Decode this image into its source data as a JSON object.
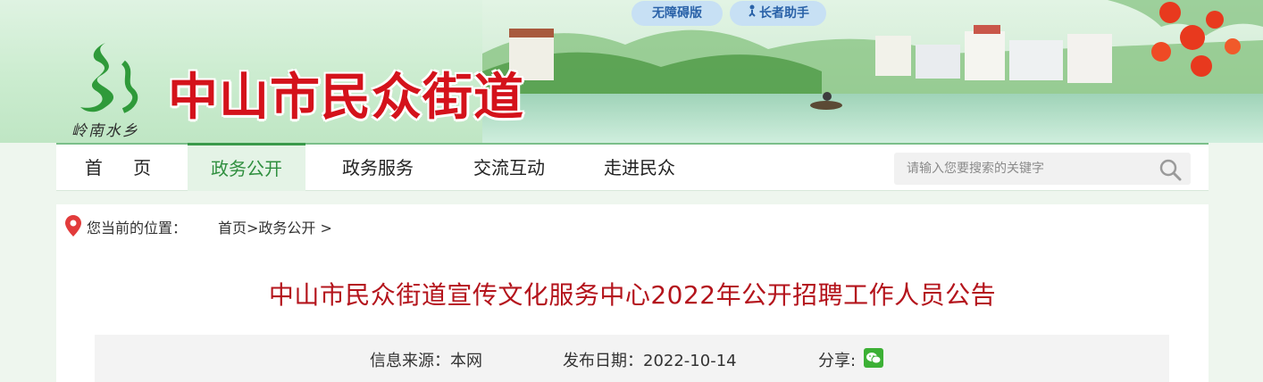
{
  "header": {
    "site_title": "中山市民众街道",
    "logo_subtitle": "岭南水乡",
    "accessibility_button": "无障碍版",
    "elderly_button": "长者助手"
  },
  "nav": {
    "items": [
      {
        "label": "首 页"
      },
      {
        "label": "政务公开"
      },
      {
        "label": "政务服务"
      },
      {
        "label": "交流互动"
      },
      {
        "label": "走进民众"
      }
    ],
    "active_index": 1
  },
  "search": {
    "placeholder": "请输入您要搜索的关键字",
    "value": ""
  },
  "breadcrumb": {
    "label": "您当前的位置：",
    "path": "首页>政务公开 >"
  },
  "article": {
    "title": "中山市民众街道宣传文化服务中心2022年公开招聘工作人员公告",
    "source": "信息来源：本网",
    "date": "发布日期：2022-10-14",
    "share_label": "分享:"
  },
  "icons": {
    "location": "map-pin-icon",
    "search": "search-icon",
    "wechat": "wechat-icon",
    "elderly": "elderly-icon"
  },
  "colors": {
    "brand_red": "#d4121b",
    "nav_active": "#2f8f3f",
    "title_red": "#b4141c",
    "pill_text": "#2a62a8"
  }
}
